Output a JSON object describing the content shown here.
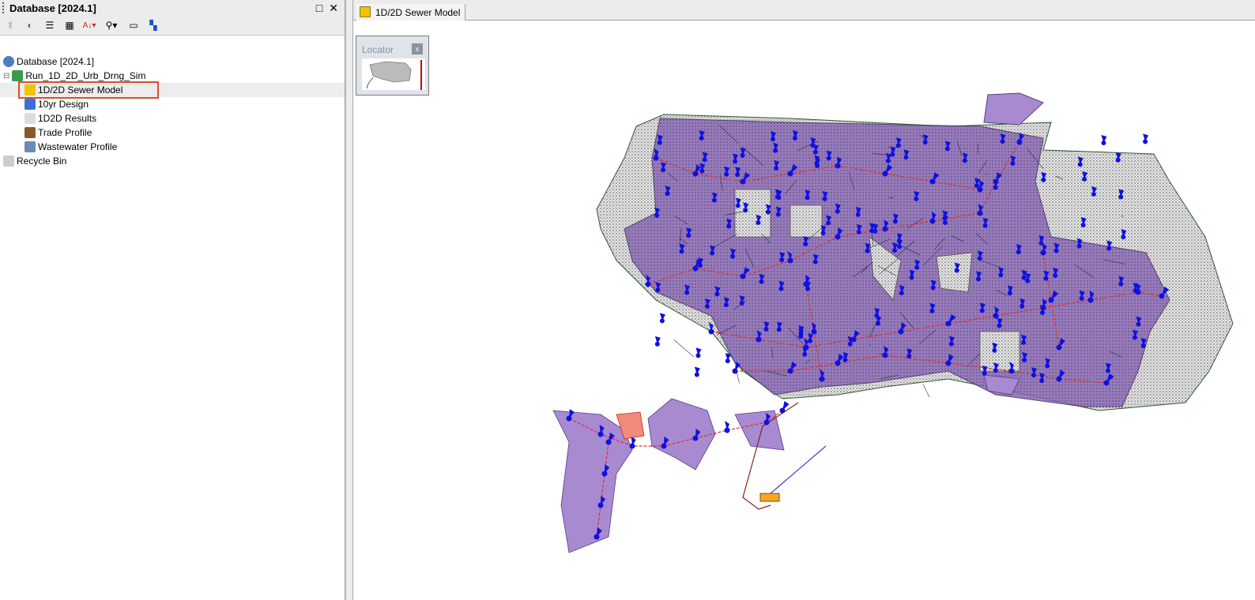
{
  "left_panel": {
    "title": "Database [2024.1]",
    "window_buttons": {
      "restore": "□",
      "close": "✕"
    },
    "toolbar": [
      "up-arrow-icon",
      "refresh-icon",
      "list-view-icon",
      "properties-icon",
      "sort-az-icon",
      "find-binoculars-icon",
      "new-window-icon",
      "network-icon"
    ],
    "tree": [
      {
        "label": "Database [2024.1]",
        "icon": "database-icon",
        "level": 0
      },
      {
        "label": "Run_1D_2D_Urb_Drng_Sim",
        "icon": "run-icon",
        "level": 1,
        "expanded": true
      },
      {
        "label": "1D/2D Sewer Model",
        "icon": "sewer-model-icon",
        "level": 2,
        "selected": true
      },
      {
        "label": "10yr Design",
        "icon": "rainfall-icon",
        "level": 2
      },
      {
        "label": "1D2D Results",
        "icon": "results-icon",
        "level": 2
      },
      {
        "label": "Trade Profile",
        "icon": "trade-profile-icon",
        "level": 2
      },
      {
        "label": "Wastewater Profile",
        "icon": "wastewater-icon",
        "level": 2
      },
      {
        "label": "Recycle Bin",
        "icon": "recycle-bin-icon",
        "level": 0
      }
    ],
    "highlight_color": "#d9502a"
  },
  "map_view": {
    "tab_label": "1D/2D Sewer Model",
    "locator": {
      "title": "Locator",
      "close": "x"
    },
    "colors": {
      "subcatchment": "#8b6bb8",
      "mesh": "#c8c8c8",
      "node": "#1010e0",
      "link": "#e03030",
      "boundary": "#2f5a2f"
    }
  }
}
